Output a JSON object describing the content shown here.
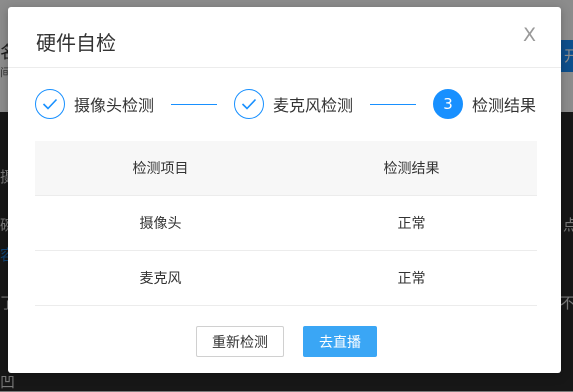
{
  "background": {
    "name_char": "名",
    "sub_char": "间",
    "btn_char": "开",
    "line1_char": "摄",
    "line2_left": "碗",
    "line2_right": "点",
    "line3_char": "容",
    "line4_left": "了",
    "line4_right": "不",
    "line5": "凹"
  },
  "modal": {
    "title": "硬件自检",
    "close": "X",
    "steps": [
      {
        "label": "摄像头检测",
        "mark": "✓",
        "state": "done"
      },
      {
        "label": "麦克风检测",
        "mark": "✓",
        "state": "done"
      },
      {
        "label": "检测结果",
        "mark": "3",
        "state": "active"
      }
    ],
    "table": {
      "headers": [
        "检测项目",
        "检测结果"
      ],
      "rows": [
        [
          "摄像头",
          "正常"
        ],
        [
          "麦克风",
          "正常"
        ]
      ]
    },
    "buttons": {
      "retest": "重新检测",
      "go_live": "去直播"
    }
  },
  "colors": {
    "accent": "#1890ff",
    "primary_button": "#3aa6f5"
  }
}
